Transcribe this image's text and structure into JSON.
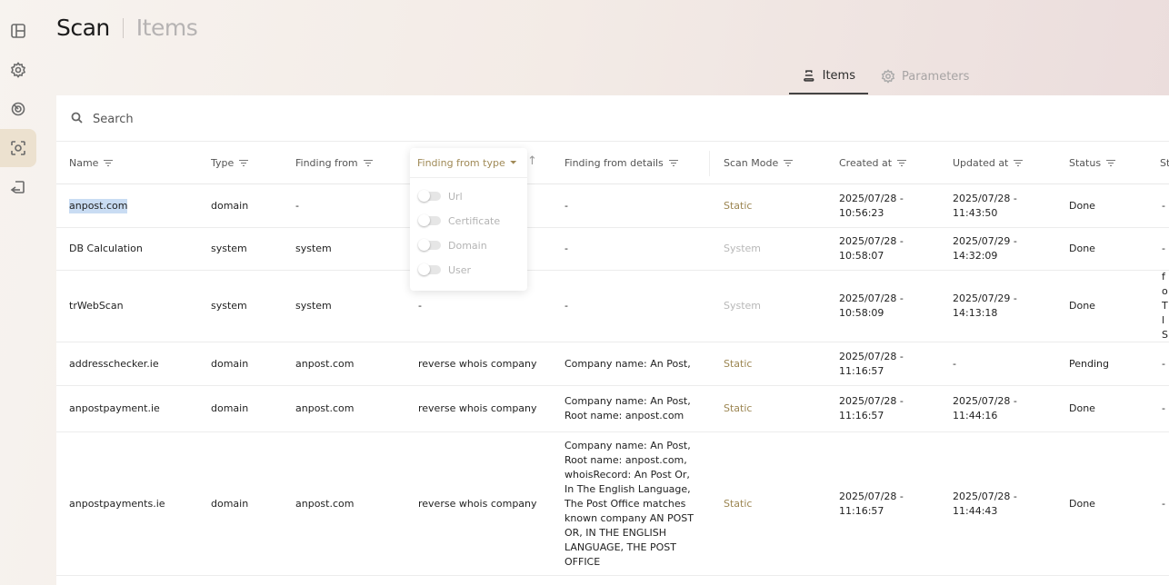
{
  "page": {
    "title": "Scan",
    "subtitle": "Items"
  },
  "sidebar": {
    "items": [
      {
        "icon": "dashboard-icon",
        "active": false
      },
      {
        "icon": "gear-icon",
        "active": false
      },
      {
        "icon": "radar-icon",
        "active": false
      },
      {
        "icon": "scan-icon",
        "active": true
      },
      {
        "icon": "return-icon",
        "active": false
      }
    ]
  },
  "tabs": [
    {
      "label": "Items",
      "icon": "stack-icon",
      "active": true
    },
    {
      "label": "Parameters",
      "icon": "gear-icon",
      "active": false
    }
  ],
  "search": {
    "placeholder": "Search",
    "value": ""
  },
  "table": {
    "columns": [
      "Name",
      "Type",
      "Finding from",
      "Finding from type",
      "Finding from details",
      "Scan Mode",
      "Created at",
      "Updated at",
      "Status",
      "St"
    ],
    "rows": [
      {
        "name": "anpost.com",
        "type": "domain",
        "finding_from": "-",
        "finding_from_type": "",
        "details": "-",
        "scan_mode": "Static",
        "created": "2025/07/28 - 10:56:23",
        "updated": "2025/07/28 - 11:43:50",
        "status": "Done",
        "extra": "-"
      },
      {
        "name": "DB Calculation",
        "type": "system",
        "finding_from": "system",
        "finding_from_type": "",
        "details": "-",
        "scan_mode": "System",
        "created": "2025/07/28 - 10:58:07",
        "updated": "2025/07/29 - 14:32:09",
        "status": "Done",
        "extra": "-"
      },
      {
        "name": "trWebScan",
        "type": "system",
        "finding_from": "system",
        "finding_from_type": "-",
        "details": "-",
        "scan_mode": "System",
        "created": "2025/07/28 - 10:58:09",
        "updated": "2025/07/29 - 14:13:18",
        "status": "Done",
        "extra": "N fo Tl Sc"
      },
      {
        "name": "addresschecker.ie",
        "type": "domain",
        "finding_from": "anpost.com",
        "finding_from_type": "reverse whois company",
        "details": "Company name: An Post,",
        "scan_mode": "Static",
        "created": "2025/07/28 - 11:16:57",
        "updated": "-",
        "status": "Pending",
        "extra": "-"
      },
      {
        "name": "anpostpayment.ie",
        "type": "domain",
        "finding_from": "anpost.com",
        "finding_from_type": "reverse whois company",
        "details": "Company name: An Post, Root name: anpost.com",
        "scan_mode": "Static",
        "created": "2025/07/28 - 11:16:57",
        "updated": "2025/07/28 - 11:44:16",
        "status": "Done",
        "extra": "-"
      },
      {
        "name": "anpostpayments.ie",
        "type": "domain",
        "finding_from": "anpost.com",
        "finding_from_type": "reverse whois company",
        "details": "Company name: An Post, Root name: anpost.com, whoisRecord: An Post Or, In The English Language, The Post Office matches known company AN POST OR, IN THE ENGLISH LANGUAGE, THE POST OFFICE",
        "scan_mode": "Static",
        "created": "2025/07/28 - 11:16:57",
        "updated": "2025/07/28 - 11:44:43",
        "status": "Done",
        "extra": "-"
      }
    ]
  },
  "filter_dropdown": {
    "header": "Finding from type",
    "options": [
      "Url",
      "Certificate",
      "Domain",
      "User"
    ]
  },
  "colors": {
    "accent": "#a08a57",
    "system": "#b8b8b8",
    "active_sidebar": "#ece1cf"
  }
}
